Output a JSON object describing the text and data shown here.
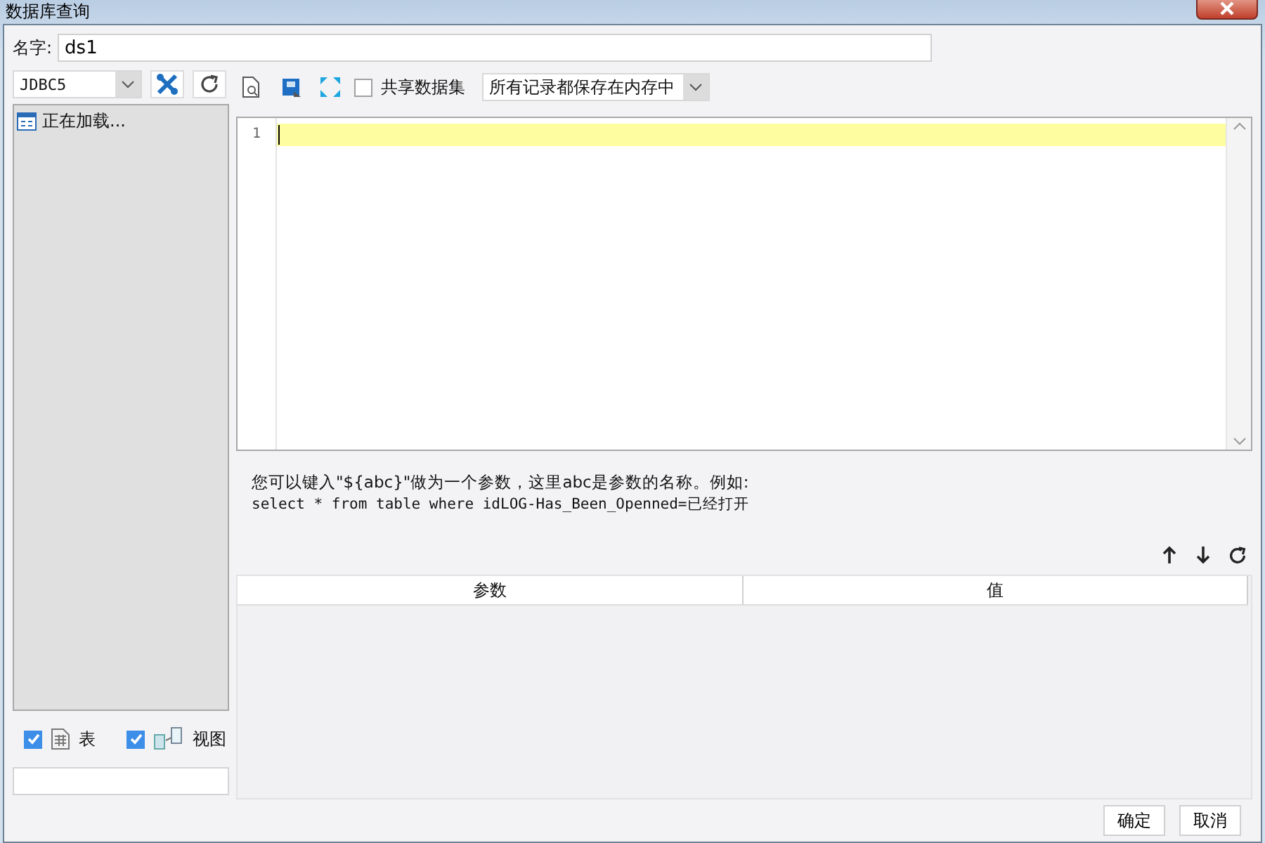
{
  "window": {
    "title": "数据库查询"
  },
  "name_field": {
    "label": "名字:",
    "value": "ds1"
  },
  "connection_select": {
    "value": "JDBC5"
  },
  "tree": {
    "items": [
      {
        "label": "正在加载..."
      }
    ]
  },
  "filters": [
    {
      "label": "表",
      "checked": true,
      "kind": "table"
    },
    {
      "label": "视图",
      "checked": true,
      "kind": "view"
    }
  ],
  "toolbar": {
    "share_checkbox": {
      "label": "共享数据集",
      "checked": false
    },
    "storage_select": {
      "value": "所有记录都保存在内存中"
    }
  },
  "editor": {
    "line_numbers": [
      "1"
    ]
  },
  "hint": {
    "line_1": "您可以键入\"${abc}\"做为一个参数，这里abc是参数的名称。例如:",
    "line_2": "select * from table where idLOG-Has_Been_Openned=已经打开"
  },
  "params_table": {
    "columns": [
      "参数",
      "值"
    ]
  },
  "buttons": [
    "确定",
    "取消"
  ]
}
